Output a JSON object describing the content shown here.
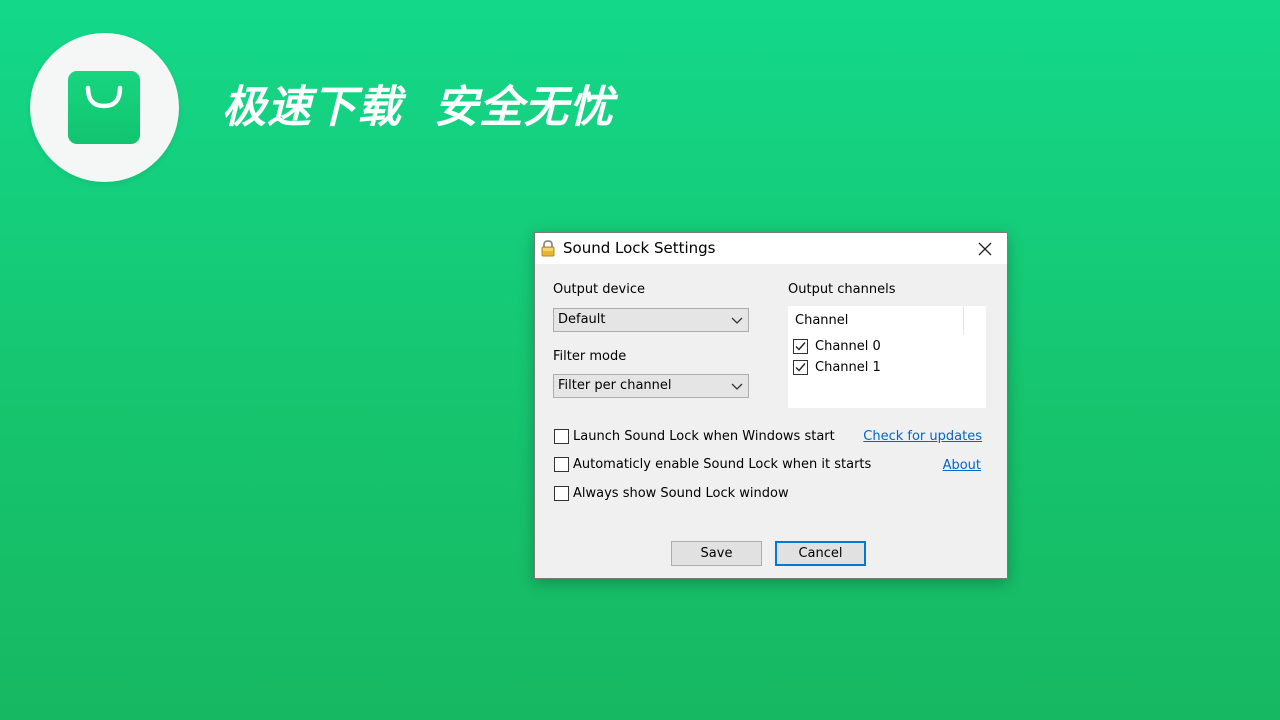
{
  "banner": {
    "slogan_part1": "极速下载",
    "slogan_part2": "安全无忧",
    "logo_icon": "shopping-bag-icon",
    "background_color": "#16c975"
  },
  "dialog": {
    "title": "Sound Lock Settings",
    "title_icon": "padlock-icon",
    "close_icon": "close-icon",
    "output_device": {
      "label": "Output device",
      "value": "Default"
    },
    "filter_mode": {
      "label": "Filter mode",
      "value": "Filter per channel"
    },
    "output_channels": {
      "label": "Output channels",
      "column_header": "Channel",
      "channels": [
        {
          "label": "Channel 0",
          "checked": true
        },
        {
          "label": "Channel 1",
          "checked": true
        }
      ]
    },
    "options": [
      {
        "label": "Launch Sound Lock when Windows start",
        "checked": false
      },
      {
        "label": "Automaticly enable Sound Lock when it starts",
        "checked": false
      },
      {
        "label": "Always show Sound Lock window",
        "checked": false
      }
    ],
    "links": {
      "check_updates": "Check for updates",
      "about": "About"
    },
    "buttons": {
      "save": "Save",
      "cancel": "Cancel"
    },
    "accent_color": "#0078d7",
    "link_color": "#0066cc"
  }
}
